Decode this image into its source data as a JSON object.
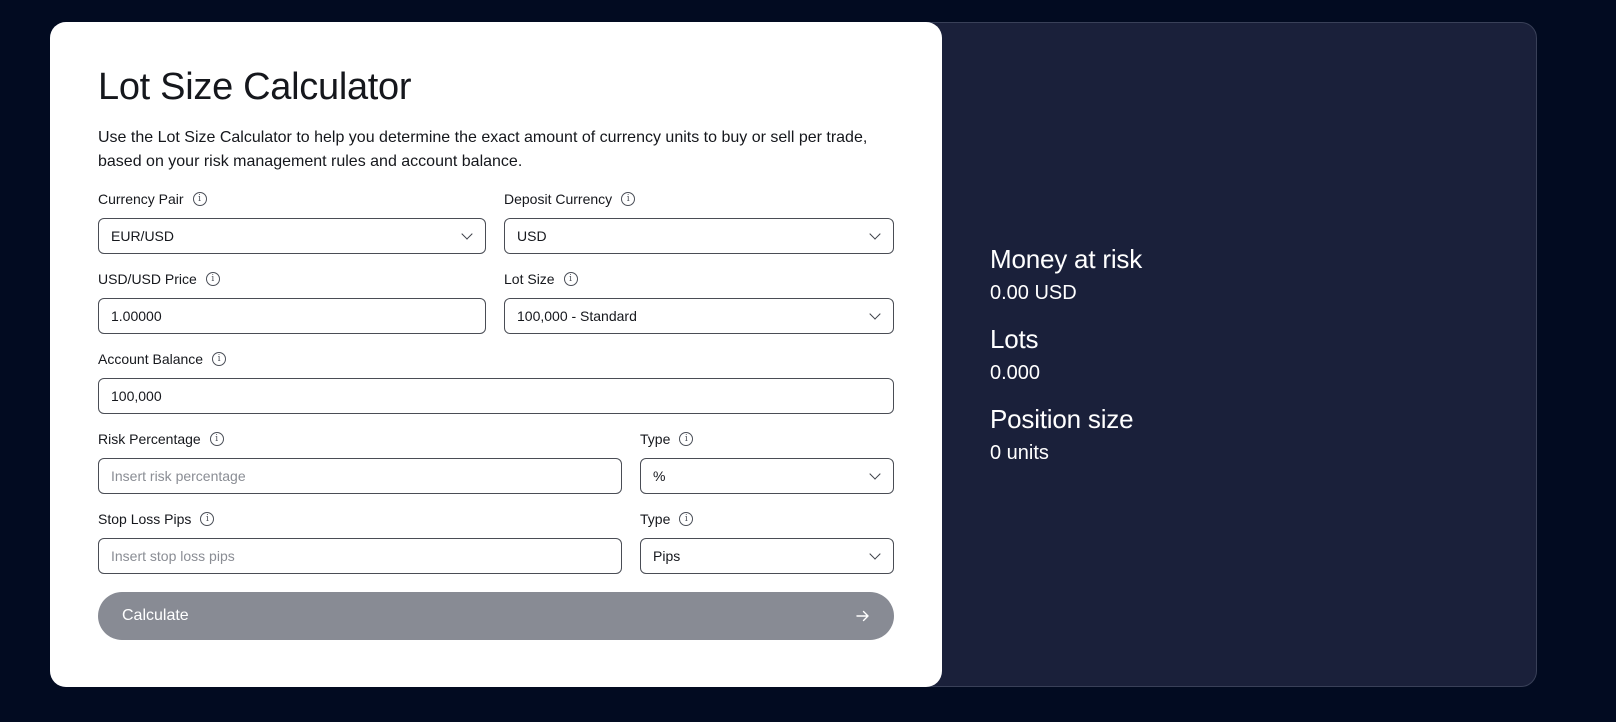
{
  "calculator": {
    "title": "Lot Size Calculator",
    "description": "Use the Lot Size Calculator to help you determine the exact amount of currency units to buy or sell per trade, based on your risk management rules and account balance.",
    "currency_pair": {
      "label": "Currency Pair",
      "value": "EUR/USD"
    },
    "deposit_currency": {
      "label": "Deposit Currency",
      "value": "USD"
    },
    "price": {
      "label": "USD/USD Price",
      "value": "1.00000"
    },
    "lot_size": {
      "label": "Lot Size",
      "value": "100,000 - Standard"
    },
    "account_balance": {
      "label": "Account Balance",
      "value": "100,000"
    },
    "risk_percentage": {
      "label": "Risk Percentage",
      "value": "",
      "placeholder": "Insert risk percentage"
    },
    "risk_type": {
      "label": "Type",
      "value": "%"
    },
    "stop_loss": {
      "label": "Stop Loss Pips",
      "value": "",
      "placeholder": "Insert stop loss pips"
    },
    "stop_loss_type": {
      "label": "Type",
      "value": "Pips"
    },
    "calculate_label": "Calculate",
    "info_glyph": "i"
  },
  "results": {
    "money_at_risk": {
      "label": "Money at risk",
      "value": "0.00 USD"
    },
    "lots": {
      "label": "Lots",
      "value": "0.000"
    },
    "position_size": {
      "label": "Position size",
      "value": "0 units"
    }
  },
  "colors": {
    "page_background": "#020b21",
    "result_panel": "#1a203a",
    "button_disabled": "#888b94",
    "text": "#15171c"
  },
  "icons": {
    "info": "info-icon",
    "dropdown": "chevron-down-icon",
    "button": "arrow-right-icon"
  }
}
